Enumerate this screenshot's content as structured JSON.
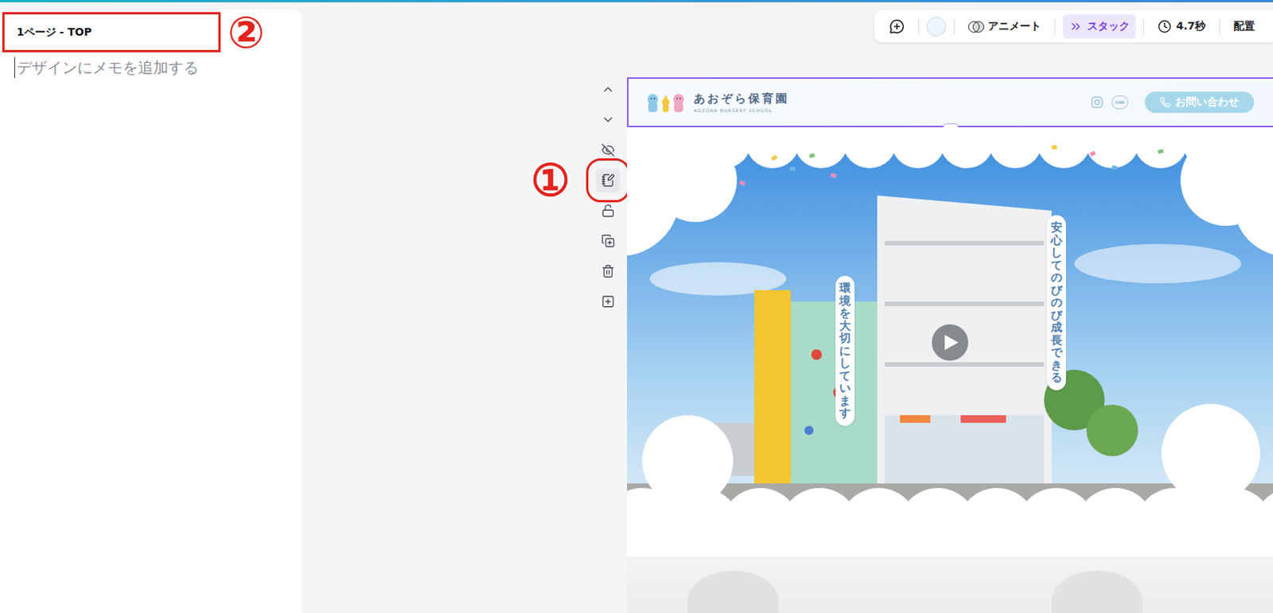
{
  "left_panel": {
    "page_title": "1ページ - TOP",
    "notes_placeholder": "デザインにメモを追加する"
  },
  "annotations": [
    {
      "label": "①",
      "target": "notes"
    },
    {
      "label": "②",
      "target": "page-title"
    }
  ],
  "toolbar": {
    "swatch_color": "#eef6fb",
    "animate": "アニメート",
    "stack": {
      "label": "スタック",
      "selected": true
    },
    "duration": "4.7秒",
    "position": "配置"
  },
  "page_tools": [
    {
      "kind": "up",
      "selected": false
    },
    {
      "kind": "down",
      "selected": false
    },
    {
      "kind": "hide",
      "selected": false
    },
    {
      "kind": "notes",
      "selected": true
    },
    {
      "kind": "lock",
      "selected": false
    },
    {
      "kind": "duplicate",
      "selected": false
    },
    {
      "kind": "delete",
      "selected": false
    },
    {
      "kind": "add",
      "selected": false
    }
  ],
  "canvas": {
    "header": {
      "selected": true,
      "logo_title": "あおぞら保育園",
      "logo_subtitle": "AOZORA NURSERY SCHOOL",
      "line_label": "LINE",
      "contact_button": "お問い合わせ"
    },
    "hero": {
      "labels": [
        "環境を大切にしています",
        "安心してのびのび成長できる"
      ]
    }
  }
}
